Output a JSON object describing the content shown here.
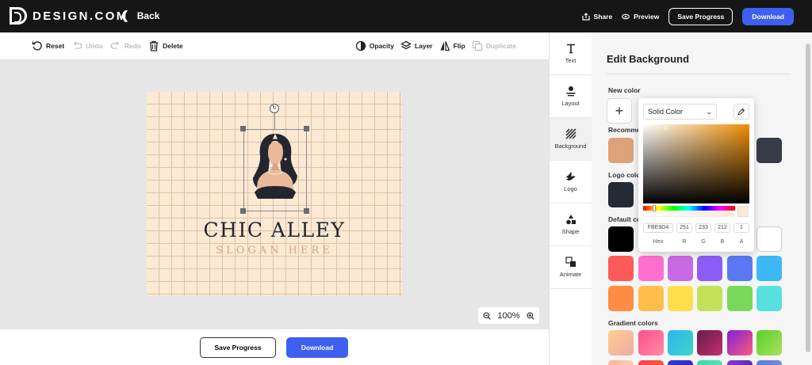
{
  "app": {
    "logo_text": "DESIGN.COM",
    "back_label": "Back",
    "share_label": "Share",
    "preview_label": "Preview",
    "save_progress_label": "Save Progress",
    "download_label": "Download"
  },
  "toolbar": {
    "reset": "Reset",
    "undo": "Undo",
    "redo": "Redo",
    "delete": "Delete",
    "opacity": "Opacity",
    "layer": "Layer",
    "flip": "Flip",
    "duplicate": "Duplicate"
  },
  "canvas": {
    "brand_name": "CHIC ALLEY",
    "slogan": "SLOGAN HERE",
    "zoom": "100%"
  },
  "bottom": {
    "save_progress": "Save Progress",
    "download": "Download"
  },
  "sidenav": [
    {
      "label": "Text",
      "icon": "text-icon"
    },
    {
      "label": "Layout",
      "icon": "layout-icon"
    },
    {
      "label": "Background",
      "icon": "background-icon"
    },
    {
      "label": "Logo",
      "icon": "bird-icon"
    },
    {
      "label": "Shape",
      "icon": "shapes-icon"
    },
    {
      "label": "Animate",
      "icon": "animate-icon"
    }
  ],
  "panel": {
    "title": "Edit Background",
    "new_color": "New color",
    "recommended": "Recomme",
    "logo_colors": "Logo colo",
    "default_colors": "Default co",
    "gradient_colors": "Gradient colors",
    "recommended_swatches": [
      "#dea27b",
      "#363b47"
    ],
    "logo_swatches": [
      "#262a36"
    ],
    "default_row1": [
      "#000000",
      "#ffffff"
    ],
    "default_row2": [
      "#ff5a5a",
      "#ff6fcf",
      "#c86ae6",
      "#8c5df6",
      "#5a78f2",
      "#3cb8f7"
    ],
    "default_row3": [
      "#ff8c42",
      "#ffbd4a",
      "#ffdd4d",
      "#c3e25a",
      "#78d85a",
      "#58e0e0"
    ],
    "gradient_row1": [
      [
        "#ffd08a",
        "#f0a8a8"
      ],
      [
        "#ff4f8b",
        "#ff8aa8"
      ],
      [
        "#2fb5f0",
        "#3ad6c8"
      ],
      [
        "#6a1a4c",
        "#c0306a"
      ],
      [
        "#7a22d8",
        "#ff5a7a"
      ],
      [
        "#5ad02a",
        "#a8e05a"
      ]
    ],
    "gradient_row2": [
      [
        "#ffb0a0",
        "#ffd0b0"
      ],
      [
        "#ff3a5a",
        "#ff5a3a"
      ],
      [
        "#2a3ad8",
        "#3a2ab8"
      ],
      [
        "#3ad8a8",
        "#5ae0c0"
      ],
      [
        "#8a3ad8",
        "#5a2ab8"
      ],
      [
        "#5a7ae0",
        "#7a8ad8"
      ]
    ]
  },
  "picker": {
    "mode": "Solid Color",
    "hex": "FBE9D4",
    "r": "251",
    "g": "233",
    "b": "212",
    "a": "1",
    "hex_label": "Hex",
    "r_label": "R",
    "g_label": "G",
    "b_label": "B",
    "a_label": "A"
  }
}
